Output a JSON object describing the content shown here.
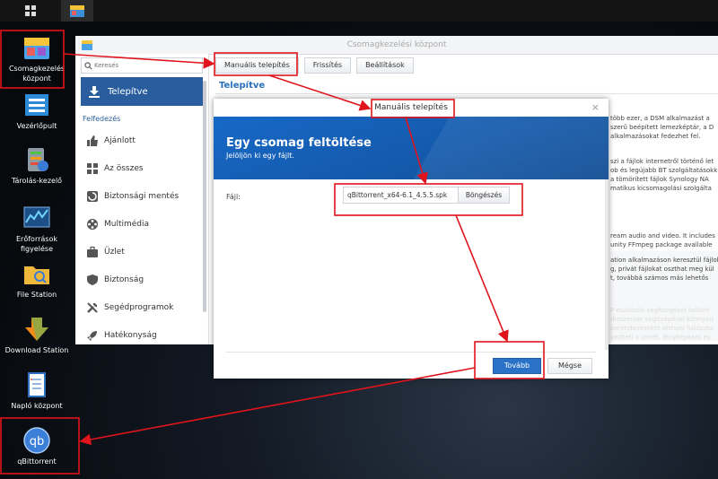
{
  "desktop": {
    "icons": [
      {
        "label": "Csomagkezelés központ"
      },
      {
        "label": "Vezérlőpult"
      },
      {
        "label": "Tárolás-kezelő"
      },
      {
        "label": "Erőforrások figyelése"
      },
      {
        "label": "File Station"
      },
      {
        "label": "Download Station"
      },
      {
        "label": "Napló központ"
      },
      {
        "label": "qBittorrent"
      }
    ]
  },
  "window": {
    "title": "Csomagkezelési központ",
    "search_placeholder": "Keresés",
    "toolbar": {
      "manual_install": "Manuális telepítés",
      "refresh": "Frissítés",
      "settings": "Beállítások"
    },
    "installed_heading": "Telepítve",
    "sidebar": {
      "active": "Telepítve",
      "section": "Felfedezés",
      "items": [
        "Ajánlott",
        "Az összes",
        "Biztonsági mentés",
        "Multimédia",
        "Üzlet",
        "Biztonság",
        "Segédprogramok",
        "Hatékonyság"
      ]
    },
    "bg_descriptions": [
      [
        "több ezer, a DSM alkalmazást a",
        "szerű beépített lemezképtár, a D",
        "alkalmazásokat fedezhet fel."
      ],
      [
        "szi a fájlok internetről történő let",
        "ob és legújabb BT szolgáltatásokk",
        "a tömörített fájlok Synology NA",
        "matikus kicsomagolási szolgálta"
      ],
      [
        "ream audio and video. It includes",
        "unity FFmpeg package available"
      ],
      [
        "ation alkalmazáson keresztül fájlok",
        "g, privát fájlokat oszthat meg kül",
        "t, továbbá számos más lehetős"
      ],
      [
        "P-eszközök segítségével tallózh",
        "diaszerver segítségével könnyed",
        "berendezéseket otthoni hálózata",
        "vezheti a zenét, fényképeket és"
      ]
    ]
  },
  "dialog": {
    "title": "Manuális telepítés",
    "heading": "Egy csomag feltöltése",
    "subheading": "Jelöljön ki egy fájlt.",
    "file_label": "Fájl:",
    "file_value": "qBittorrent_x64-6.1_4.5.5.spk",
    "browse": "Böngészés",
    "next": "Tovább",
    "cancel": "Mégse",
    "close": "×"
  },
  "colors": {
    "accent": "#2a5d9e",
    "annotation": "#e0141c"
  }
}
